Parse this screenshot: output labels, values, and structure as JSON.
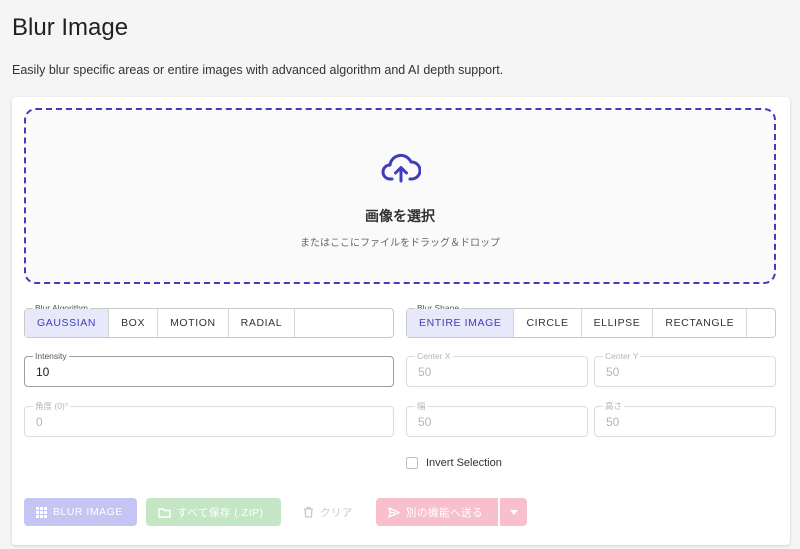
{
  "page": {
    "title": "Blur Image",
    "description": "Easily blur specific areas or entire images with advanced algorithm and AI depth support."
  },
  "dropzone": {
    "title": "画像を選択",
    "subtitle": "またはここにファイルをドラッグ＆ドロップ",
    "icon": "cloud-upload-icon"
  },
  "algorithm": {
    "legend": "Blur Algorithm",
    "options": [
      "GAUSSIAN",
      "BOX",
      "MOTION",
      "RADIAL"
    ],
    "selected": "GAUSSIAN"
  },
  "shape": {
    "legend": "Blur Shape",
    "options": [
      "ENTIRE IMAGE",
      "CIRCLE",
      "ELLIPSE",
      "RECTANGLE"
    ],
    "selected": "ENTIRE IMAGE"
  },
  "fields": {
    "intensity": {
      "label": "Intensity",
      "value": "10"
    },
    "center_x": {
      "label": "Center X",
      "value": "50"
    },
    "center_y": {
      "label": "Center Y",
      "value": "50"
    },
    "angle": {
      "label": "角度 (0)°",
      "value": "0"
    },
    "width": {
      "label": "幅",
      "value": "50"
    },
    "height": {
      "label": "高さ",
      "value": "50"
    }
  },
  "invert": {
    "label": "Invert Selection",
    "checked": false
  },
  "buttons": {
    "blur": "BLUR IMAGE",
    "save_all": "すべて保存 (.ZIP)",
    "clear": "クリア",
    "send": "別の機能へ送る"
  },
  "colors": {
    "accent": "#3f3dbd",
    "blur_button_disabled": "#c5c5f3",
    "save_button_disabled": "#c4e6c5",
    "send_button_disabled": "#f7c0cc"
  }
}
